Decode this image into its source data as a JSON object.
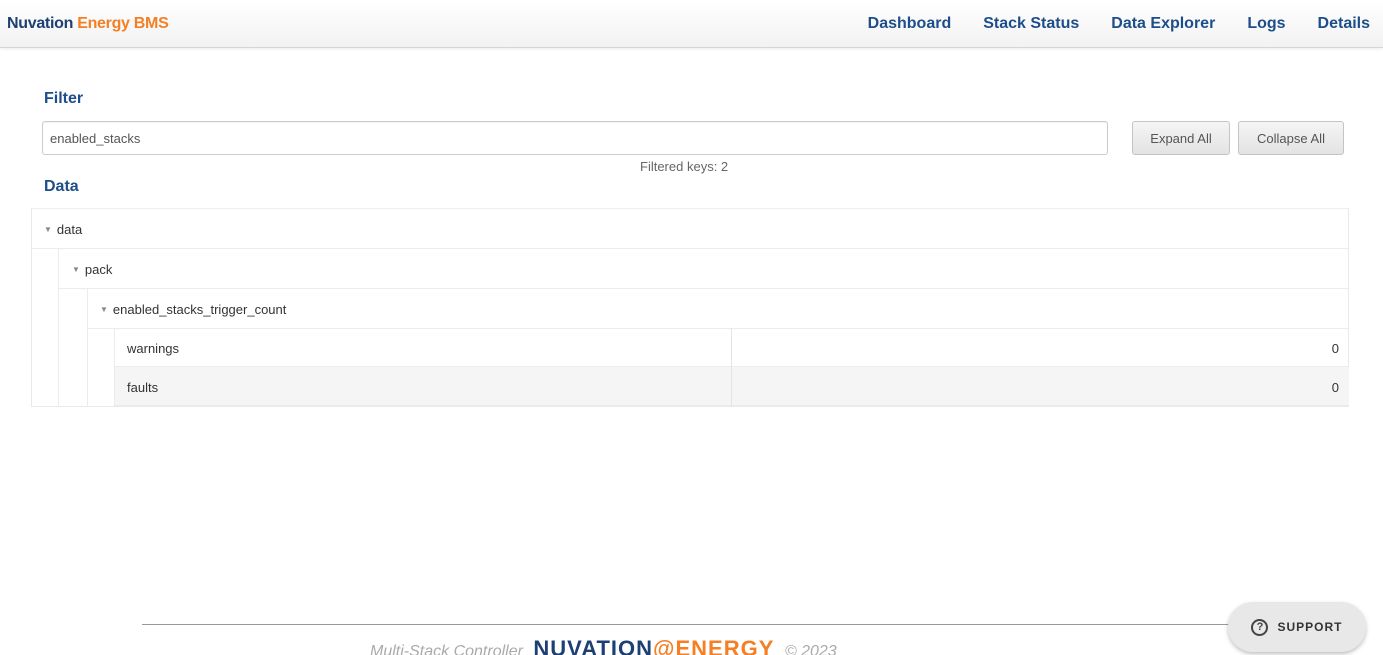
{
  "brand": {
    "part1": "Nuvation",
    "part2": "Energy BMS"
  },
  "nav": [
    "Dashboard",
    "Stack Status",
    "Data Explorer",
    "Logs",
    "Details"
  ],
  "filter": {
    "heading": "Filter",
    "value": "enabled_stacks",
    "expand_label": "Expand All",
    "collapse_label": "Collapse All",
    "filtered_keys": "Filtered keys: 2"
  },
  "data_section": {
    "heading": "Data",
    "tree": {
      "root": "data",
      "child": "pack",
      "grandchild": "enabled_stacks_trigger_count",
      "leaves": [
        {
          "key": "warnings",
          "value": "0"
        },
        {
          "key": "faults",
          "value": "0"
        }
      ]
    }
  },
  "footer": {
    "controller": "Multi-Stack Controller",
    "logo_part1": "NUVATION",
    "logo_part2": "@ENERGY",
    "copyright": "© 2023"
  },
  "support": {
    "label": "SUPPORT",
    "icon": "question-circle-icon"
  },
  "colors": {
    "brand_blue": "#1d3f73",
    "brand_orange": "#f47f24",
    "link_blue": "#1d4e8a"
  }
}
